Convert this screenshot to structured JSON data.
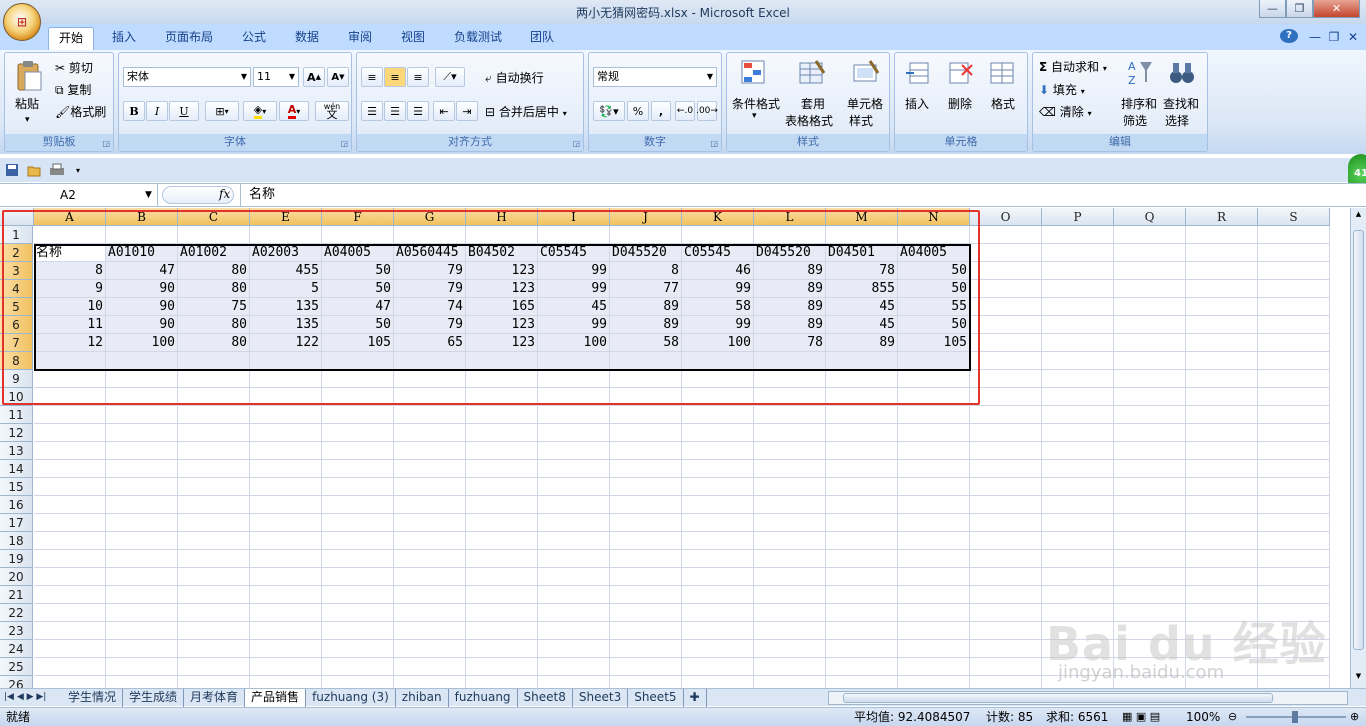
{
  "app": {
    "title": "两小无猜网密码.xlsx - Microsoft Excel",
    "office_button": "⊞",
    "help": "?",
    "window_controls": [
      "—",
      "❐",
      "✕"
    ],
    "doc_controls": [
      "—",
      "❐",
      "✕"
    ]
  },
  "ribbon_tabs": [
    "开始",
    "插入",
    "页面布局",
    "公式",
    "数据",
    "审阅",
    "视图",
    "负载测试",
    "团队"
  ],
  "ribbon": {
    "clipboard": {
      "label": "剪贴板",
      "paste": "粘贴",
      "cut": "剪切",
      "copy": "复制",
      "format_painter": "格式刷"
    },
    "font": {
      "label": "字体",
      "family": "宋体",
      "size": "11",
      "bold": "B",
      "italic": "I",
      "underline": "U",
      "grow": "A",
      "shrink": "A",
      "wen": "wén",
      "wen2": "文",
      "color_a": "A"
    },
    "alignment": {
      "label": "对齐方式",
      "wrap": "自动换行",
      "merge": "合并后居中"
    },
    "number": {
      "label": "数字",
      "format": "常规",
      "percent": "%",
      "comma": ","
    },
    "styles": {
      "label": "样式",
      "conditional": "条件格式",
      "table1": "套用",
      "table2": "表格格式",
      "cell1": "单元格",
      "cell2": "样式"
    },
    "cells": {
      "label": "单元格",
      "insert": "插入",
      "delete": "删除",
      "format": "格式"
    },
    "editing": {
      "label": "编辑",
      "autosum": "自动求和",
      "fill": "填充",
      "clear": "清除",
      "sort1": "排序和",
      "sort2": "筛选",
      "find1": "查找和",
      "find2": "选择",
      "sigma": "Σ"
    }
  },
  "formula_bar": {
    "name_box": "A2",
    "fx": "fx",
    "value": "名称"
  },
  "sheet": {
    "columns": [
      "A",
      "B",
      "C",
      "E",
      "F",
      "G",
      "H",
      "I",
      "J",
      "K",
      "L",
      "M",
      "N",
      "O",
      "P",
      "Q",
      "R",
      "S"
    ],
    "rows": [
      "1",
      "2",
      "3",
      "4",
      "5",
      "6",
      "7",
      "8",
      "9",
      "10",
      "11",
      "12",
      "13",
      "14",
      "15",
      "16",
      "17",
      "18",
      "19",
      "20",
      "21",
      "22",
      "23",
      "24",
      "25",
      "26"
    ],
    "header_row": [
      "名称",
      "A01010",
      "A01002",
      "A02003",
      "A04005",
      "A0560445",
      "B04502",
      "C05545",
      "D045520",
      "C05545",
      "D045520",
      "D04501",
      "A04005"
    ],
    "data": [
      [
        "8",
        "47",
        "80",
        "455",
        "50",
        "79",
        "123",
        "99",
        "8",
        "46",
        "89",
        "78",
        "50"
      ],
      [
        "9",
        "90",
        "80",
        "5",
        "50",
        "79",
        "123",
        "99",
        "77",
        "99",
        "89",
        "855",
        "50"
      ],
      [
        "10",
        "90",
        "75",
        "135",
        "47",
        "74",
        "165",
        "45",
        "89",
        "58",
        "89",
        "45",
        "55"
      ],
      [
        "11",
        "90",
        "80",
        "135",
        "50",
        "79",
        "123",
        "99",
        "89",
        "99",
        "89",
        "45",
        "50"
      ],
      [
        "12",
        "100",
        "80",
        "122",
        "105",
        "65",
        "123",
        "100",
        "58",
        "100",
        "78",
        "89",
        "105"
      ]
    ]
  },
  "sheet_tabs": [
    "学生情况",
    "学生成绩",
    "月考体育",
    "产品销售",
    "fuzhuang (3)",
    "zhiban",
    "fuzhuang",
    "Sheet8",
    "Sheet3",
    "Sheet5"
  ],
  "active_sheet_index": 3,
  "status": {
    "ready": "就绪",
    "average": "平均值: 92.4084507",
    "count": "计数: 85",
    "sum": "求和: 6561",
    "zoom": "100%"
  },
  "watermark": {
    "main": "Bai du 经验",
    "url": "jingyan.baidu.com"
  },
  "badge": "41"
}
